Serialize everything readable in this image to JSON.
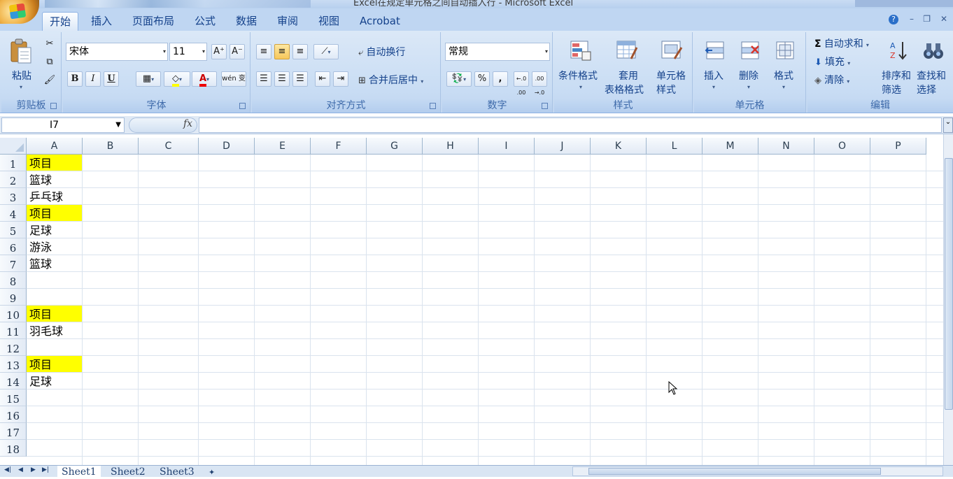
{
  "window": {
    "title": "Excel在规定单元格之间自动插入行 - Microsoft Excel"
  },
  "ribbon_tabs": [
    "开始",
    "插入",
    "页面布局",
    "公式",
    "数据",
    "审阅",
    "视图",
    "Acrobat"
  ],
  "active_tab": "开始",
  "clipboard": {
    "paste_label": "粘贴",
    "group_label": "剪贴板"
  },
  "font": {
    "name": "宋体",
    "size": "11",
    "group_label": "字体",
    "grow": "A⁺",
    "shrink": "A⁻",
    "bold": "B",
    "italic": "I",
    "underline": "U",
    "phonetic": "wén 变"
  },
  "alignment": {
    "wrap_label": "自动换行",
    "merge_label": "合并后居中",
    "group_label": "对齐方式"
  },
  "number": {
    "format": "常规",
    "percent": "%",
    "comma": ",",
    "inc_decimal": "←.0 .00",
    "dec_decimal": ".00 →.0",
    "group_label": "数字"
  },
  "styles": {
    "cond_format": "条件格式",
    "table_format_1": "套用",
    "table_format_2": "表格格式",
    "cell_styles_1": "单元格",
    "cell_styles_2": "样式",
    "group_label": "样式"
  },
  "cells": {
    "insert": "插入",
    "delete": "删除",
    "format": "格式",
    "group_label": "单元格"
  },
  "editing": {
    "autosum": "自动求和",
    "fill": "填充",
    "clear": "清除",
    "sort_1": "排序和",
    "sort_2": "筛选",
    "find_1": "查找和",
    "find_2": "选择",
    "group_label": "编辑"
  },
  "formula_bar": {
    "name_box": "I7",
    "fx": "fx",
    "formula": ""
  },
  "columns": [
    "A",
    "B",
    "C",
    "D",
    "E",
    "F",
    "G",
    "H",
    "I",
    "J",
    "K",
    "L",
    "M",
    "N",
    "O",
    "P"
  ],
  "rows": [
    "1",
    "2",
    "3",
    "4",
    "5",
    "6",
    "7",
    "8",
    "9",
    "10",
    "11",
    "12",
    "13",
    "14",
    "15",
    "16",
    "17",
    "18"
  ],
  "cells_data": [
    {
      "row": 1,
      "col": "A",
      "value": "项目",
      "highlight": true
    },
    {
      "row": 2,
      "col": "A",
      "value": "篮球",
      "highlight": false
    },
    {
      "row": 3,
      "col": "A",
      "value": "乒乓球",
      "highlight": false
    },
    {
      "row": 4,
      "col": "A",
      "value": "项目",
      "highlight": true
    },
    {
      "row": 5,
      "col": "A",
      "value": "足球",
      "highlight": false
    },
    {
      "row": 6,
      "col": "A",
      "value": "游泳",
      "highlight": false
    },
    {
      "row": 7,
      "col": "A",
      "value": "篮球",
      "highlight": false
    },
    {
      "row": 10,
      "col": "A",
      "value": "项目",
      "highlight": true
    },
    {
      "row": 11,
      "col": "A",
      "value": "羽毛球",
      "highlight": false
    },
    {
      "row": 13,
      "col": "A",
      "value": "项目",
      "highlight": true
    },
    {
      "row": 14,
      "col": "A",
      "value": "足球",
      "highlight": false
    }
  ],
  "highlight_color": "#ffff00",
  "sheets": [
    "Sheet1",
    "Sheet2",
    "Sheet3"
  ],
  "active_sheet": "Sheet1"
}
